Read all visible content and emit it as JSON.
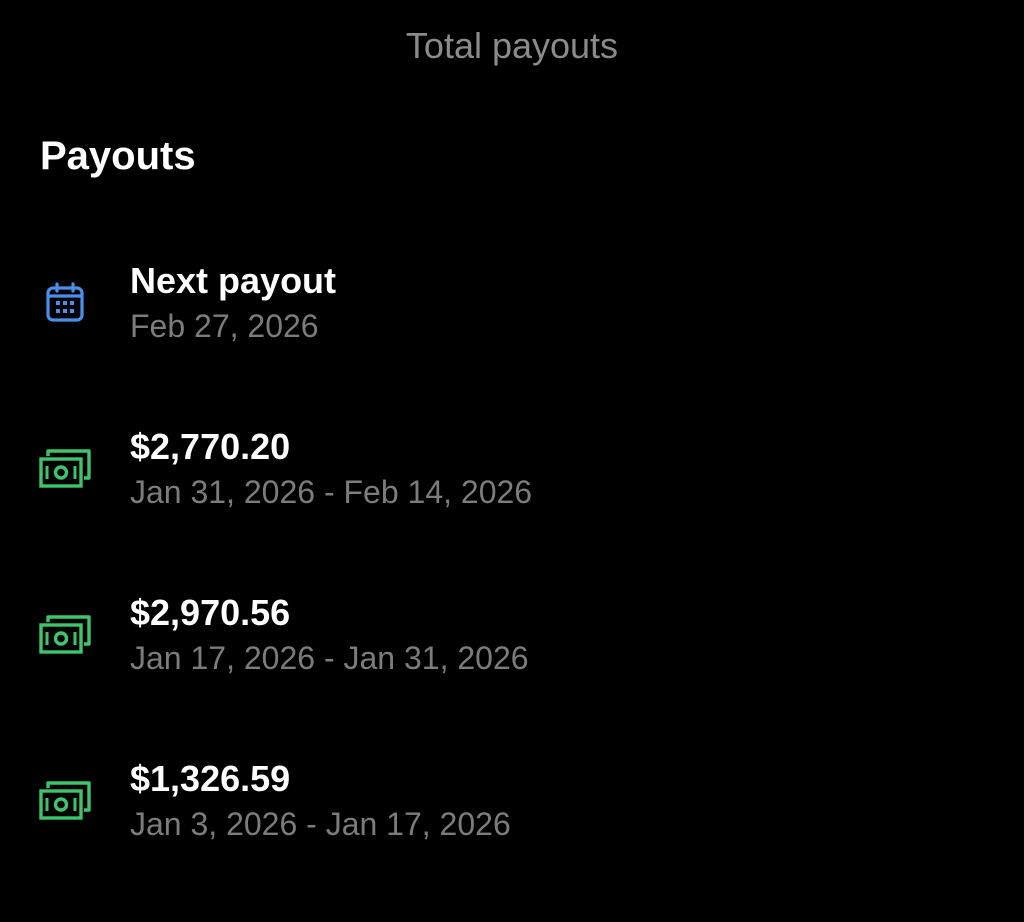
{
  "header": {
    "title": "Total payouts"
  },
  "section": {
    "heading": "Payouts"
  },
  "colors": {
    "calendar_icon": "#4a90e8",
    "money_icon": "#3ec46d",
    "secondary_text": "#7c7c7c",
    "header_text": "#8b8b8b"
  },
  "payouts": [
    {
      "icon": "calendar-icon",
      "primary": "Next payout",
      "secondary": "Feb 27, 2026"
    },
    {
      "icon": "money-icon",
      "primary": "$2,770.20",
      "secondary": "Jan 31, 2026 - Feb 14, 2026"
    },
    {
      "icon": "money-icon",
      "primary": "$2,970.56",
      "secondary": "Jan 17, 2026 - Jan 31, 2026"
    },
    {
      "icon": "money-icon",
      "primary": "$1,326.59",
      "secondary": "Jan 3, 2026 - Jan 17, 2026"
    }
  ]
}
